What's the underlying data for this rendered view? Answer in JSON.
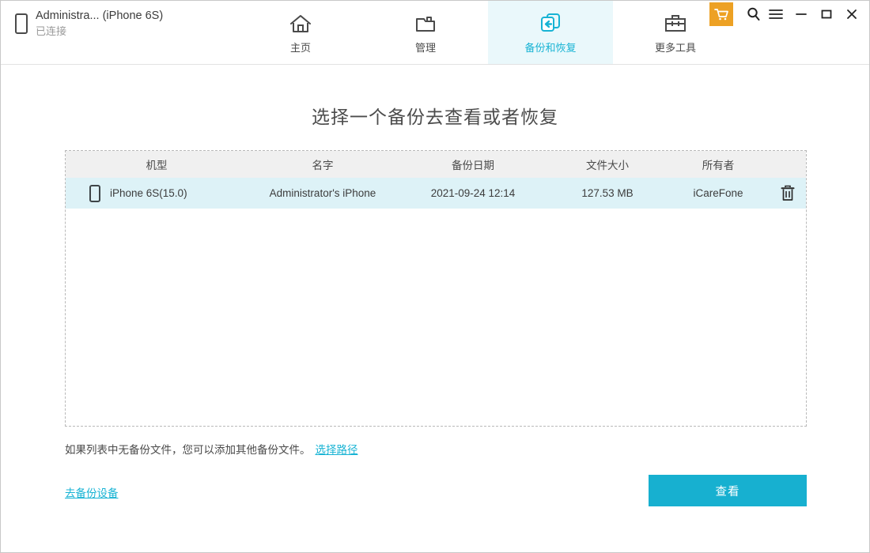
{
  "window": {
    "device": {
      "name": "Administra... (iPhone 6S)",
      "status": "已连接",
      "icon": "phone-icon"
    },
    "controls": {
      "cart_icon": "shopping-cart-icon",
      "search_icon": "search-icon",
      "menu_icon": "hamburger-menu-icon",
      "minimize_icon": "minimize-icon",
      "maximize_icon": "maximize-icon",
      "close_icon": "close-icon"
    }
  },
  "nav": {
    "tabs": [
      {
        "id": "home",
        "label": "主页",
        "icon": "home-icon",
        "active": false
      },
      {
        "id": "manage",
        "label": "管理",
        "icon": "folder-icon",
        "active": false
      },
      {
        "id": "backup",
        "label": "备份和恢复",
        "icon": "restore-icon",
        "active": true
      },
      {
        "id": "tools",
        "label": "更多工具",
        "icon": "toolbox-icon",
        "active": false
      }
    ]
  },
  "main": {
    "title": "选择一个备份去查看或者恢复",
    "table": {
      "columns": [
        "机型",
        "名字",
        "备份日期",
        "文件大小",
        "所有者"
      ],
      "rows": [
        {
          "model": "iPhone 6S(15.0)",
          "name": "Administrator's iPhone",
          "date": "2021-09-24 12:14",
          "size": "127.53 MB",
          "owner": "iCareFone",
          "delete_icon": "trash-icon",
          "selected": true
        }
      ]
    },
    "hint": {
      "text": "如果列表中无备份文件，您可以添加其他备份文件。",
      "link_label": "选择路径"
    },
    "backup_link_label": "去备份设备",
    "primary_button_label": "查看"
  },
  "colors": {
    "accent": "#17b0d0",
    "accent_light": "#ddf2f7",
    "tab_active_bg": "#eaf8fb",
    "cart_orange": "#eda124",
    "header_row_bg": "#f0f0f0"
  }
}
